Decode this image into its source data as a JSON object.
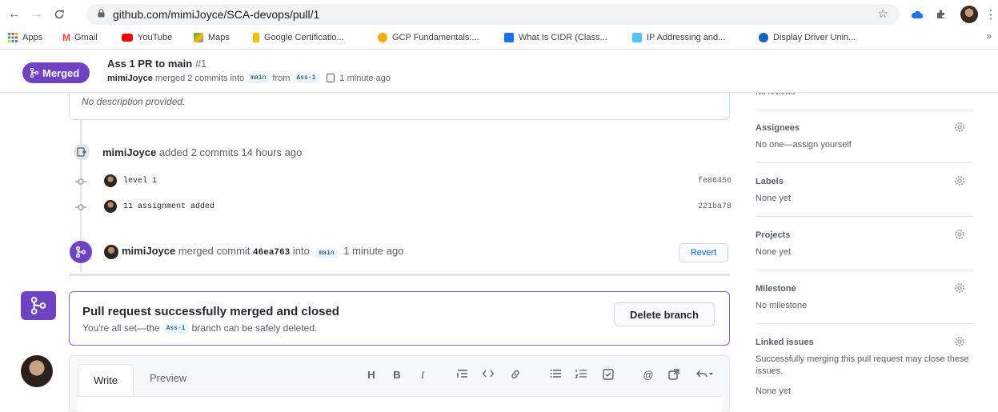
{
  "browser": {
    "url": "github.com/mimiJoyce/SCA-devops/pull/1",
    "bookmarks": [
      {
        "label": "Apps",
        "color": "#4285f4"
      },
      {
        "label": "Gmail",
        "color": "#ea4335"
      },
      {
        "label": "YouTube",
        "color": "#ff0000"
      },
      {
        "label": "Maps",
        "color": "#34a853"
      },
      {
        "label": "Google Certificatio...",
        "color": "#fbbc04"
      },
      {
        "label": "GCP Fundamentals:...",
        "color": "#f9ab00"
      },
      {
        "label": "What Is CIDR (Class...",
        "color": "#1a73e8"
      },
      {
        "label": "IP Addressing and...",
        "color": "#4fc3f7"
      },
      {
        "label": "Display Driver Unin...",
        "color": "#1565c0"
      }
    ],
    "bookmarks_more": "»"
  },
  "pr": {
    "status": "Merged",
    "title": "Ass 1 PR to main",
    "number": "#1",
    "author": "mimiJoyce",
    "merged_text": "merged 2 commits into",
    "base_branch": "main",
    "from_text": "from",
    "head_branch": "Ass-1",
    "time": "1 minute ago"
  },
  "description": "No description provided.",
  "commits_event": {
    "author": "mimiJoyce",
    "text": "added 2 commits 14 hours ago"
  },
  "commits": [
    {
      "message": "level 1",
      "sha": "fe86456"
    },
    {
      "message": "11 assignment added",
      "sha": "221ba78"
    }
  ],
  "merge_event": {
    "author": "mimiJoyce",
    "merged_commit": "merged commit",
    "commit_sha": "46ea763",
    "into": "into",
    "branch": "main",
    "time": "1 minute ago",
    "revert_label": "Revert"
  },
  "merged_box": {
    "title": "Pull request successfully merged and closed",
    "sub_prefix": "You're all set—the",
    "branch": "Ass-1",
    "sub_suffix": "branch can be safely deleted.",
    "delete_label": "Delete branch"
  },
  "editor": {
    "tab_write": "Write",
    "tab_preview": "Preview",
    "tools": [
      "H",
      "B",
      "I",
      "quote",
      "code",
      "link",
      "bullets",
      "numbered",
      "task",
      "mention",
      "reference",
      "reply"
    ]
  },
  "sidebar": {
    "reviewers_value": "No reviews",
    "sections": [
      {
        "heading": "Assignees",
        "value": "No one—assign yourself"
      },
      {
        "heading": "Labels",
        "value": "None yet"
      },
      {
        "heading": "Projects",
        "value": "None yet"
      },
      {
        "heading": "Milestone",
        "value": "No milestone"
      },
      {
        "heading": "Linked issues",
        "value": "Successfully merging this pull request may close these issues.",
        "value2": "None yet"
      }
    ]
  }
}
